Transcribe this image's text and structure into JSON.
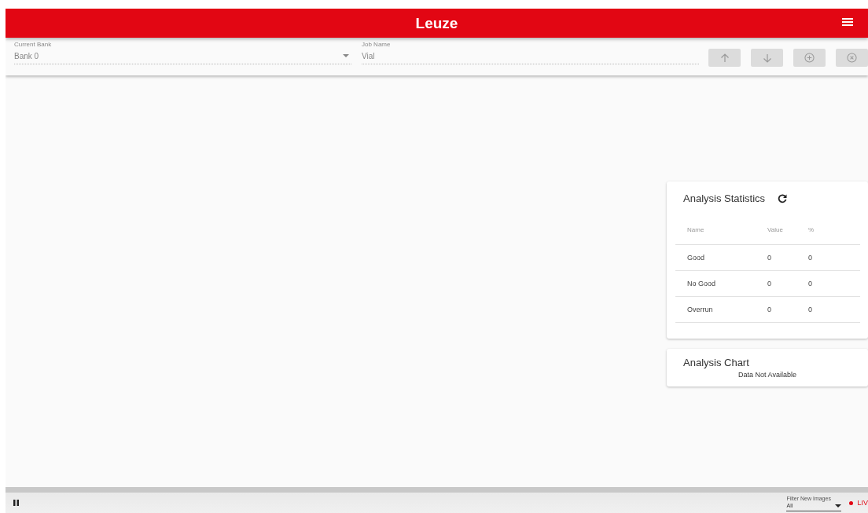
{
  "header": {
    "brand": "Leuze"
  },
  "toolbar": {
    "bank": {
      "label": "Current Bank",
      "value": "Bank 0"
    },
    "job": {
      "label": "Job Name",
      "value": "Vial"
    },
    "buttons": [
      {
        "kind": "up",
        "disabled": true
      },
      {
        "kind": "down",
        "disabled": true
      },
      {
        "kind": "add",
        "disabled": true
      },
      {
        "kind": "remove",
        "disabled": true
      }
    ]
  },
  "statistics": {
    "title": "Analysis Statistics",
    "columns": [
      "Name",
      "Value",
      "%"
    ],
    "rows": [
      [
        "Good",
        "0",
        "0"
      ],
      [
        "No Good",
        "0",
        "0"
      ],
      [
        "Overrun",
        "0",
        "0"
      ]
    ]
  },
  "chart_card": {
    "title": "Analysis Chart",
    "message": "Data Not Available"
  },
  "footer": {
    "filter": {
      "label": "Filter New Images",
      "value": "All"
    },
    "live": "LIV"
  }
}
